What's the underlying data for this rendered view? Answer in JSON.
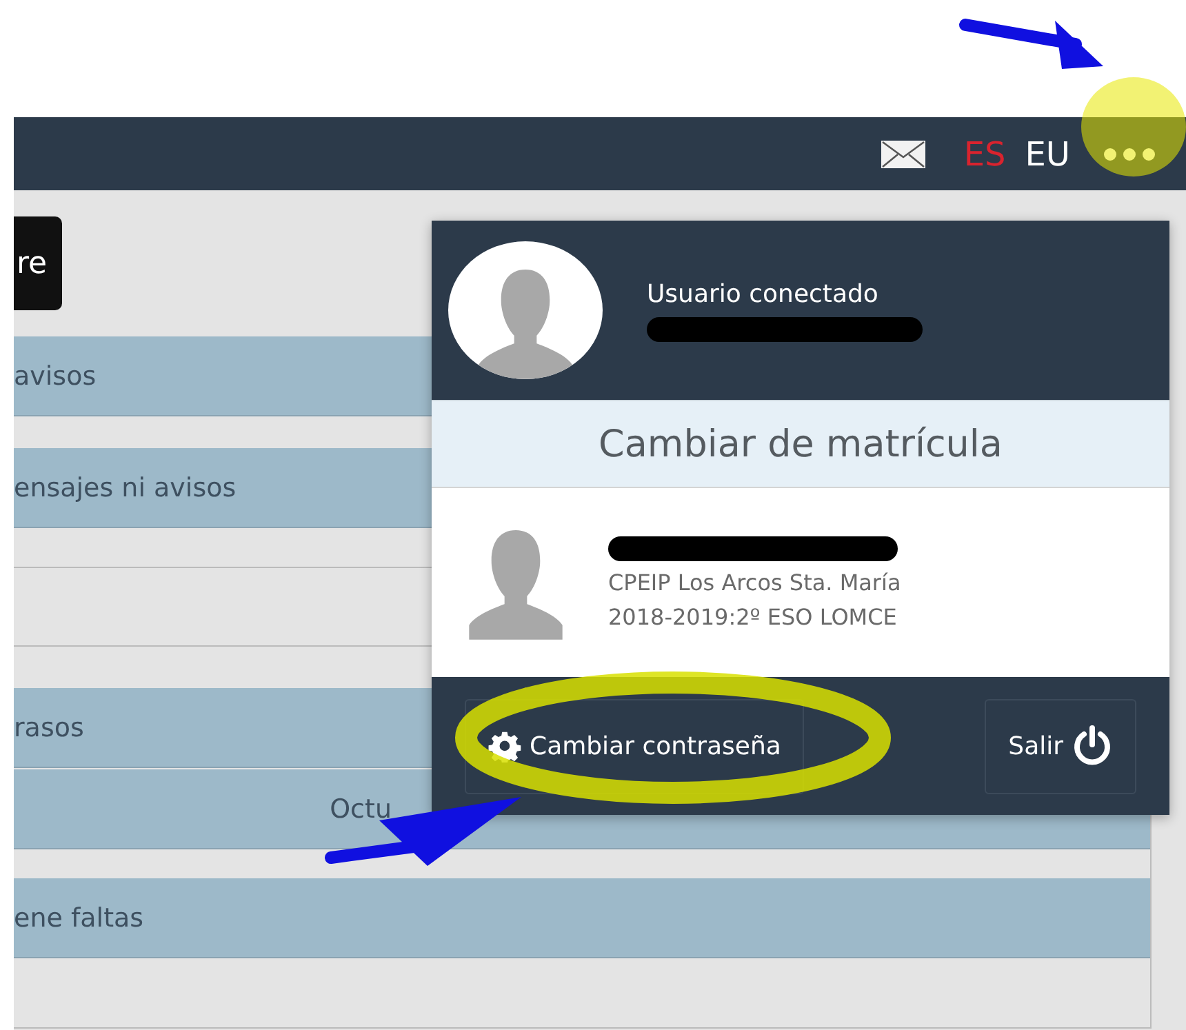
{
  "nav": {
    "languages": [
      {
        "label": "ES",
        "selected": true
      },
      {
        "label": "EU",
        "selected": false
      }
    ]
  },
  "left_button": {
    "label": "re"
  },
  "rows": [
    {
      "kind": "bar",
      "text": "avisos"
    },
    {
      "kind": "bar",
      "text": "ensajes ni avisos"
    },
    {
      "kind": "blank"
    },
    {
      "kind": "bar",
      "text": "rasos"
    },
    {
      "kind": "bar-right",
      "text": "Octu"
    },
    {
      "kind": "bar",
      "text": "ene faltas"
    }
  ],
  "user_menu": {
    "status": "Usuario conectado",
    "section_title": "Cambiar de matrícula",
    "enrollment": {
      "school": "CPEIP Los Arcos Sta. María",
      "course": "2018-2019:2º ESO LOMCE"
    },
    "buttons": [
      {
        "kind": "settings",
        "label": "Cambiar contraseña"
      },
      {
        "kind": "logout",
        "label": "Salir"
      }
    ]
  }
}
